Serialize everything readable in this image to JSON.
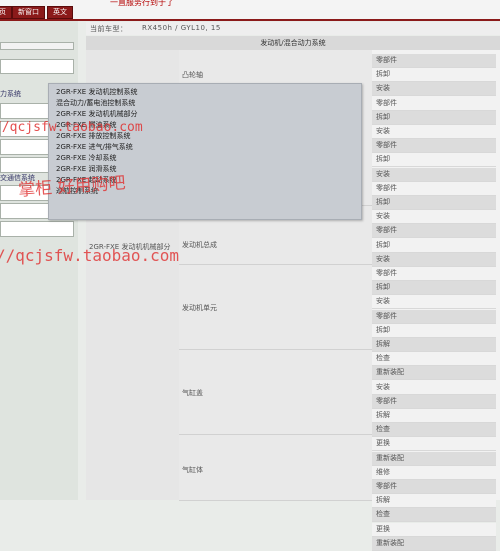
{
  "header": {
    "top_title": "一直服务行到于了",
    "buttons": [
      {
        "label": "首页"
      },
      {
        "label": "新窗口"
      },
      {
        "label": "英文"
      }
    ]
  },
  "left_panel": {
    "labels": [
      "力系统",
      "交通信系统"
    ]
  },
  "vehicle": {
    "label": "当前车型：",
    "value": "RX450h / GYL10, 15"
  },
  "table": {
    "header": "发动机/混合动力系统",
    "system_label": "2GR-FXE 发动机机械部分",
    "subsections": [
      {
        "label": "凸轮轴"
      },
      {
        "label": "发动机总成"
      },
      {
        "label": "发动机单元"
      },
      {
        "label": "气缸盖"
      },
      {
        "label": "气缸体"
      }
    ],
    "actions": [
      "零部件",
      "拆卸",
      "安装",
      "零部件",
      "拆卸",
      "安装",
      "零部件",
      "拆卸",
      "安装",
      "零部件",
      "拆卸",
      "安装",
      "零部件",
      "拆卸",
      "安装",
      "零部件",
      "拆卸",
      "安装",
      "零部件",
      "拆卸",
      "拆解",
      "检查",
      "重新装配",
      "安装",
      "零部件",
      "拆解",
      "检查",
      "更换",
      "重新装配",
      "维修",
      "零部件",
      "拆解",
      "检查",
      "更换",
      "重新装配"
    ]
  },
  "dropdown": {
    "items": [
      "2GR-FXE 发动机控制系统",
      "混合动力/蓄电池控制系统",
      "2GR-FXE 发动机机械部分",
      "2GR-FXE 燃油系统",
      "2GR-FXE 排放控制系统",
      "2GR-FXE 进气/排气系统",
      "2GR-FXE 冷却系统",
      "2GR-FXE 润滑系统",
      "2GR-FXE 起动系统",
      "巡航控制系统"
    ]
  },
  "watermarks": [
    "//qcjsfw.taobao.com",
    "掌柜  好用购吧",
    "//qcjsfw.taobao.com"
  ]
}
